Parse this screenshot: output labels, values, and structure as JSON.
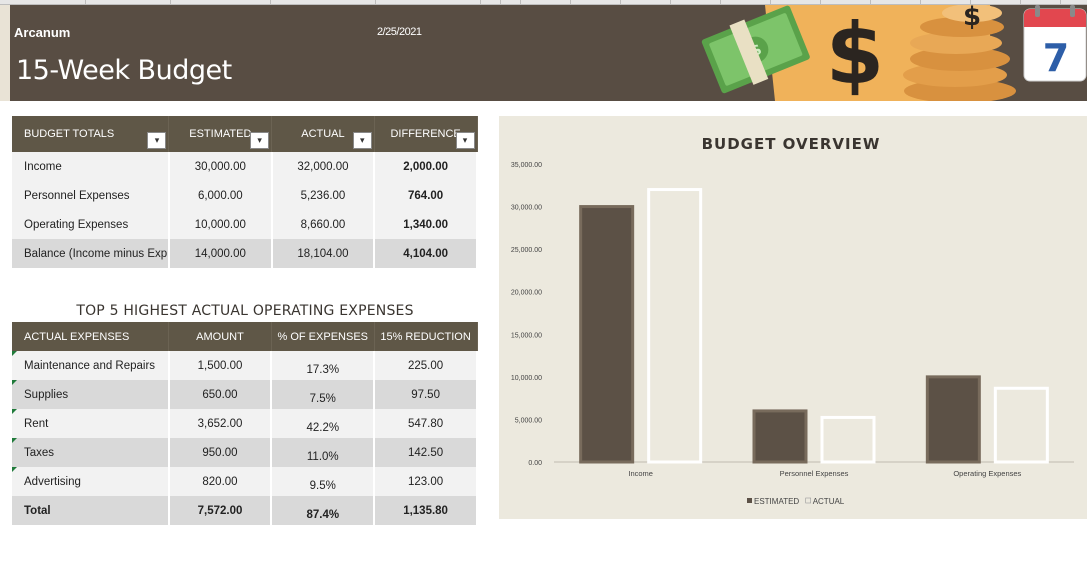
{
  "header": {
    "company": "Arcanum",
    "date": "2/25/2021",
    "title": "15-Week Budget"
  },
  "budget_totals": {
    "columns": [
      "BUDGET TOTALS",
      "ESTIMATED",
      "ACTUAL",
      "DIFFERENCE"
    ],
    "rows": [
      {
        "label": "Income",
        "estimated": "30,000.00",
        "actual": "32,000.00",
        "difference": "2,000.00"
      },
      {
        "label": "Personnel Expenses",
        "estimated": "6,000.00",
        "actual": "5,236.00",
        "difference": "764.00"
      },
      {
        "label": "Operating Expenses",
        "estimated": "10,000.00",
        "actual": "8,660.00",
        "difference": "1,340.00"
      },
      {
        "label": "Balance (Income minus Exp",
        "estimated": "14,000.00",
        "actual": "18,104.00",
        "difference": "4,104.00"
      }
    ],
    "dropdown_glyph": "▾"
  },
  "top5": {
    "title": "TOP 5 HIGHEST ACTUAL OPERATING EXPENSES",
    "columns": [
      "ACTUAL EXPENSES",
      "AMOUNT",
      "% OF EXPENSES",
      "15% REDUCTION"
    ],
    "rows": [
      {
        "label": "Maintenance and Repairs",
        "amount": "1,500.00",
        "pct": "17.3%",
        "reduction": "225.00"
      },
      {
        "label": "Supplies",
        "amount": "650.00",
        "pct": "7.5%",
        "reduction": "97.50"
      },
      {
        "label": "Rent",
        "amount": "3,652.00",
        "pct": "42.2%",
        "reduction": "547.80"
      },
      {
        "label": "Taxes",
        "amount": "950.00",
        "pct": "11.0%",
        "reduction": "142.50"
      },
      {
        "label": "Advertising",
        "amount": "820.00",
        "pct": "9.5%",
        "reduction": "123.00"
      }
    ],
    "total": {
      "label": "Total",
      "amount": "7,572.00",
      "pct": "87.4%",
      "reduction": "1,135.80"
    }
  },
  "banner_art": {
    "dollar_sign": "$",
    "calendar_day": "7"
  },
  "colors": {
    "banner": "#584d43",
    "header_row": "#5f5747",
    "estimated_bar": "#5c5146",
    "actual_bar": "#ece9de",
    "chart_bg": "#ece9de"
  },
  "chart_data": {
    "type": "bar",
    "title": "BUDGET OVERVIEW",
    "categories": [
      "Income",
      "Personnel Expenses",
      "Operating Expenses"
    ],
    "series": [
      {
        "name": "ESTIMATED",
        "values": [
          30000,
          6000,
          10000
        ]
      },
      {
        "name": "ACTUAL",
        "values": [
          32000,
          5236,
          8660
        ]
      }
    ],
    "yticks": [
      "0.00",
      "5,000.00",
      "10,000.00",
      "15,000.00",
      "20,000.00",
      "25,000.00",
      "30,000.00",
      "35,000.00"
    ],
    "ylim": [
      0,
      35000
    ],
    "grid": false,
    "legend": "bottom"
  }
}
